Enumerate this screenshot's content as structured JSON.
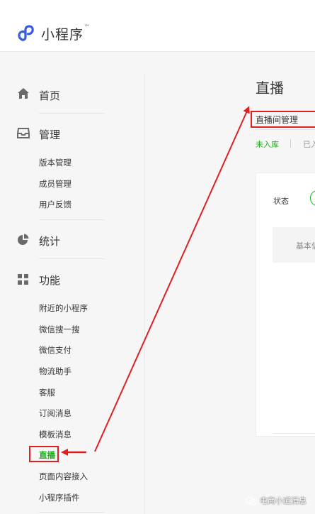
{
  "header": {
    "app_name": "小程序",
    "trademark": "™"
  },
  "sidebar": {
    "sections": [
      {
        "title": "首页",
        "icon": "home-icon",
        "items": []
      },
      {
        "title": "管理",
        "icon": "inbox-icon",
        "items": [
          "版本管理",
          "成员管理",
          "用户反馈"
        ]
      },
      {
        "title": "统计",
        "icon": "pie-chart-icon",
        "items": []
      },
      {
        "title": "功能",
        "icon": "grid-icon",
        "items": [
          "附近的小程序",
          "微信搜一搜",
          "微信支付",
          "物流助手",
          "客服",
          "订阅消息",
          "模板消息",
          "直播",
          "页面内容接入",
          "小程序插件"
        ]
      }
    ],
    "active_item": "直播"
  },
  "main": {
    "title": "直播",
    "tab": "直播间管理",
    "subtabs": [
      "未入库",
      "已入"
    ],
    "status_label": "状态",
    "basic_label": "基本信"
  },
  "watermark": "电商小道消息",
  "colors": {
    "accent": "#1aad19",
    "highlight": "#e02020",
    "logo": "#3a5bdc"
  }
}
